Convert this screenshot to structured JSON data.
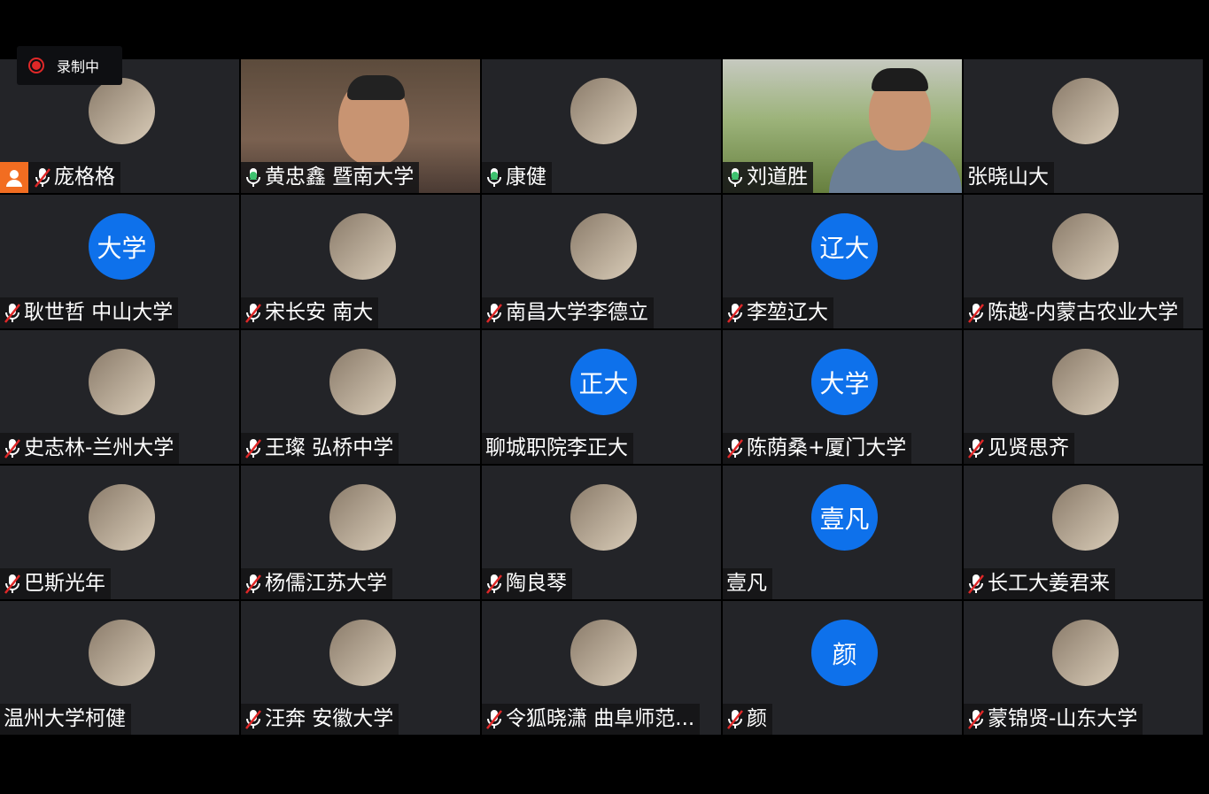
{
  "recording": {
    "label": "录制中"
  },
  "participants": [
    {
      "name": "庞格格",
      "mic": "muted",
      "avatar": {
        "type": "image"
      },
      "host": true
    },
    {
      "name": "黄忠鑫 暨南大学",
      "mic": "on",
      "avatar": {
        "type": "video"
      },
      "active": true
    },
    {
      "name": "康健",
      "mic": "on",
      "avatar": {
        "type": "image"
      }
    },
    {
      "name": "刘道胜",
      "mic": "on",
      "avatar": {
        "type": "video"
      }
    },
    {
      "name": "张晓山大",
      "mic": "none",
      "avatar": {
        "type": "image"
      }
    },
    {
      "name": "耿世哲 中山大学",
      "mic": "muted",
      "avatar": {
        "type": "text",
        "text": "大学"
      }
    },
    {
      "name": "宋长安 南大",
      "mic": "muted",
      "avatar": {
        "type": "image"
      }
    },
    {
      "name": "南昌大学李德立",
      "mic": "muted",
      "avatar": {
        "type": "image"
      }
    },
    {
      "name": "李堃辽大",
      "mic": "muted",
      "avatar": {
        "type": "text",
        "text": "辽大"
      }
    },
    {
      "name": "陈越-内蒙古农业大学",
      "mic": "muted",
      "avatar": {
        "type": "image"
      }
    },
    {
      "name": "史志林-兰州大学",
      "mic": "muted",
      "avatar": {
        "type": "image"
      }
    },
    {
      "name": "王璨  弘桥中学",
      "mic": "muted",
      "avatar": {
        "type": "image"
      }
    },
    {
      "name": "聊城职院李正大",
      "mic": "none",
      "avatar": {
        "type": "text",
        "text": "正大"
      }
    },
    {
      "name": "陈荫桑+厦门大学",
      "mic": "muted",
      "avatar": {
        "type": "text",
        "text": "大学"
      }
    },
    {
      "name": "见贤思齐",
      "mic": "muted",
      "avatar": {
        "type": "image"
      }
    },
    {
      "name": "巴斯光年",
      "mic": "muted",
      "avatar": {
        "type": "image"
      }
    },
    {
      "name": "杨儒江苏大学",
      "mic": "muted",
      "avatar": {
        "type": "image"
      }
    },
    {
      "name": "陶良琴",
      "mic": "muted",
      "avatar": {
        "type": "image"
      }
    },
    {
      "name": "壹凡",
      "mic": "none",
      "avatar": {
        "type": "text",
        "text": "壹凡"
      }
    },
    {
      "name": "长工大姜君来",
      "mic": "muted",
      "avatar": {
        "type": "image"
      }
    },
    {
      "name": "温州大学柯健",
      "mic": "none",
      "avatar": {
        "type": "image"
      }
    },
    {
      "name": "汪奔  安徽大学",
      "mic": "muted",
      "avatar": {
        "type": "image"
      }
    },
    {
      "name": "令狐晓潇 曲阜师范...",
      "mic": "muted",
      "avatar": {
        "type": "image"
      }
    },
    {
      "name": "颜",
      "mic": "muted",
      "avatar": {
        "type": "text",
        "text": "颜"
      }
    },
    {
      "name": "蒙锦贤-山东大学",
      "mic": "muted",
      "avatar": {
        "type": "image"
      }
    }
  ],
  "colors": {
    "avatar_blue": "#0e71eb",
    "active_border": "#3ec26f",
    "host_badge": "#f26d21",
    "rec_red": "#e02828"
  }
}
